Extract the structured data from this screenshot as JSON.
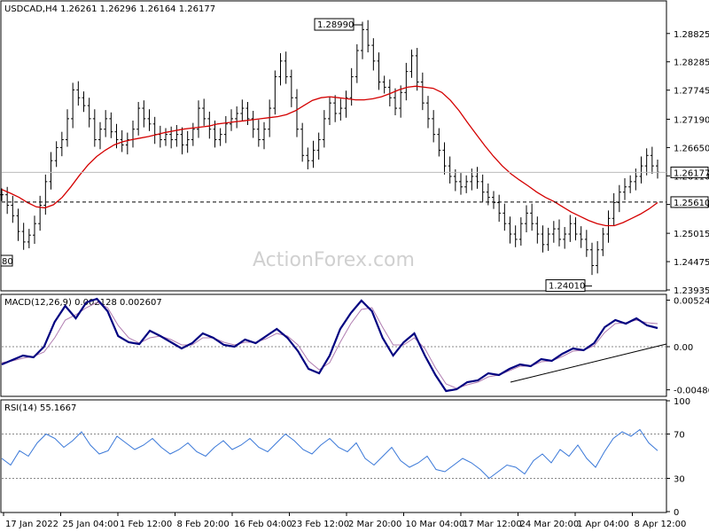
{
  "chart_data": [
    {
      "type": "ohlc",
      "header": "USDCAD,H4  1.26261 1.26296 1.26164 1.26177",
      "symbol": "USDCAD",
      "timeframe": "H4",
      "ohlc_last": {
        "open": 1.26261,
        "high": 1.26296,
        "low": 1.26164,
        "close": 1.26177
      },
      "ylim": [
        1.23935,
        1.2943
      ],
      "yticks": [
        "1.28825",
        "1.28285",
        "1.27745",
        "1.27190",
        "1.26650",
        "1.26110",
        "1.25565",
        "1.25015",
        "1.24475",
        "1.23935"
      ],
      "current_price": "1.26177",
      "support_level": "1.25610",
      "left_tag": "80",
      "annotations": [
        {
          "text": "1.28990",
          "value": 1.2899,
          "kind": "high"
        },
        {
          "text": "1.24010",
          "value": 1.2401,
          "kind": "low"
        }
      ],
      "close_series": [
        1.2575,
        1.2555,
        1.2535,
        1.2505,
        1.2485,
        1.2498,
        1.252,
        1.2555,
        1.26,
        1.264,
        1.2665,
        1.268,
        1.272,
        1.2775,
        1.276,
        1.2745,
        1.272,
        1.268,
        1.27,
        1.272,
        1.2695,
        1.268,
        1.267,
        1.268,
        1.27,
        1.274,
        1.272,
        1.271,
        1.269,
        1.268,
        1.269,
        1.268,
        1.269,
        1.267,
        1.268,
        1.27,
        1.274,
        1.272,
        1.27,
        1.268,
        1.269,
        1.271,
        1.272,
        1.273,
        1.274,
        1.272,
        1.27,
        1.268,
        1.27,
        1.274,
        1.28,
        1.283,
        1.28,
        1.276,
        1.27,
        1.265,
        1.264,
        1.266,
        1.268,
        1.272,
        1.275,
        1.273,
        1.274,
        1.276,
        1.28,
        1.285,
        1.289,
        1.286,
        1.283,
        1.279,
        1.278,
        1.276,
        1.274,
        1.277,
        1.281,
        1.284,
        1.279,
        1.275,
        1.272,
        1.269,
        1.266,
        1.263,
        1.261,
        1.26,
        1.259,
        1.26,
        1.261,
        1.26,
        1.258,
        1.257,
        1.256,
        1.254,
        1.252,
        1.25,
        1.249,
        1.252,
        1.254,
        1.252,
        1.25,
        1.248,
        1.25,
        1.251,
        1.249,
        1.25,
        1.252,
        1.25,
        1.249,
        1.247,
        1.244,
        1.247,
        1.25,
        1.253,
        1.256,
        1.258,
        1.259,
        1.26,
        1.261,
        1.263,
        1.265,
        1.263,
        1.2618
      ],
      "ma_series": [
        1.2585,
        1.2578,
        1.257,
        1.256,
        1.2552,
        1.255,
        1.2556,
        1.257,
        1.259,
        1.2612,
        1.2632,
        1.2648,
        1.266,
        1.267,
        1.2676,
        1.268,
        1.2683,
        1.2686,
        1.269,
        1.2694,
        1.2697,
        1.27,
        1.2702,
        1.2704,
        1.2706,
        1.271,
        1.2712,
        1.2714,
        1.2716,
        1.2718,
        1.272,
        1.2722,
        1.2724,
        1.2728,
        1.2735,
        1.2745,
        1.2755,
        1.276,
        1.2762,
        1.276,
        1.2758,
        1.2756,
        1.2756,
        1.2758,
        1.2762,
        1.2768,
        1.2775,
        1.278,
        1.2782,
        1.278,
        1.2778,
        1.277,
        1.2755,
        1.2735,
        1.2712,
        1.269,
        1.2668,
        1.2648,
        1.263,
        1.2615,
        1.2603,
        1.2592,
        1.258,
        1.257,
        1.2562,
        1.2552,
        1.2542,
        1.2534,
        1.2526,
        1.252,
        1.2516,
        1.2516,
        1.2522,
        1.253,
        1.2538,
        1.2548,
        1.256
      ],
      "oscillators": [
        {
          "name": "MACD(12,26,9) 0.002128 0.002607",
          "yticks": [
            "0.005249",
            "0.00",
            "-0.004865"
          ],
          "ylim": [
            -0.0055,
            0.0058
          ],
          "macd": [
            -0.002,
            -0.0015,
            -0.001,
            -0.0012,
            0.0,
            0.0028,
            0.0046,
            0.0032,
            0.005,
            0.0054,
            0.004,
            0.0012,
            0.0005,
            0.0003,
            0.0018,
            0.0012,
            0.0005,
            -0.0002,
            0.0004,
            0.0015,
            0.001,
            0.0002,
            0.0,
            0.0008,
            0.0004,
            0.0012,
            0.002,
            0.001,
            -0.0005,
            -0.0025,
            -0.003,
            -0.001,
            0.002,
            0.0038,
            0.0052,
            0.004,
            0.001,
            -0.001,
            0.0005,
            0.0015,
            -0.001,
            -0.0032,
            -0.005,
            -0.0048,
            -0.004,
            -0.0038,
            -0.003,
            -0.0032,
            -0.0025,
            -0.002,
            -0.0022,
            -0.0014,
            -0.0016,
            -0.0008,
            -0.0002,
            -0.0004,
            0.0004,
            0.0022,
            0.003,
            0.0026,
            0.0032,
            0.0024,
            0.0021
          ],
          "signal": [
            -0.0018,
            -0.0016,
            -0.0013,
            -0.0011,
            -0.0006,
            0.001,
            0.003,
            0.0036,
            0.0044,
            0.005,
            0.0044,
            0.0024,
            0.001,
            0.0004,
            0.001,
            0.0012,
            0.0008,
            0.0002,
            0.0002,
            0.001,
            0.001,
            0.0005,
            0.0002,
            0.0005,
            0.0005,
            0.0009,
            0.0015,
            0.0012,
            0.0002,
            -0.0016,
            -0.0026,
            -0.0018,
            0.0005,
            0.0026,
            0.0042,
            0.0044,
            0.0022,
            0.0002,
            0.0002,
            0.001,
            -0.0002,
            -0.0024,
            -0.0042,
            -0.0047,
            -0.0043,
            -0.004,
            -0.0034,
            -0.0032,
            -0.0027,
            -0.0022,
            -0.0022,
            -0.0017,
            -0.0016,
            -0.0011,
            -0.0005,
            -0.0004,
            0.0001,
            0.0016,
            0.0026,
            0.0027,
            0.003,
            0.0027,
            0.0026
          ],
          "trendline": {
            "from": -0.004,
            "to": 0.0003
          }
        },
        {
          "name": "RSI(14) 55.1667",
          "yticks": [
            "100",
            "70",
            "30",
            "0"
          ],
          "ylim": [
            0,
            100
          ],
          "levels": [
            70,
            30
          ],
          "values": [
            48,
            42,
            55,
            50,
            62,
            70,
            66,
            58,
            64,
            72,
            60,
            52,
            55,
            68,
            62,
            56,
            60,
            66,
            58,
            52,
            56,
            62,
            54,
            50,
            58,
            64,
            56,
            60,
            66,
            58,
            54,
            62,
            70,
            64,
            56,
            52,
            60,
            66,
            58,
            54,
            62,
            48,
            42,
            50,
            58,
            46,
            40,
            44,
            50,
            38,
            36,
            42,
            48,
            44,
            38,
            30,
            36,
            42,
            40,
            34,
            46,
            52,
            44,
            56,
            50,
            60,
            48,
            40,
            54,
            66,
            72,
            68,
            74,
            62,
            55
          ]
        }
      ],
      "x_ticks": [
        "17 Jan 2022",
        "25 Jan 04:00",
        "1 Feb 12:00",
        "8 Feb 20:00",
        "16 Feb 04:00",
        "23 Feb 12:00",
        "2 Mar 20:00",
        "10 Mar 04:00",
        "17 Mar 12:00",
        "24 Mar 20:00",
        "1 Apr 04:00",
        "8 Apr 12:00"
      ],
      "watermark": "ActionForex.com",
      "colors": {
        "bars": "#000000",
        "ma": "#d40000",
        "macd": "#000080",
        "signal": "#b07cb0",
        "rsi": "#3a78d8",
        "grid_dash": "#888888"
      }
    }
  ]
}
